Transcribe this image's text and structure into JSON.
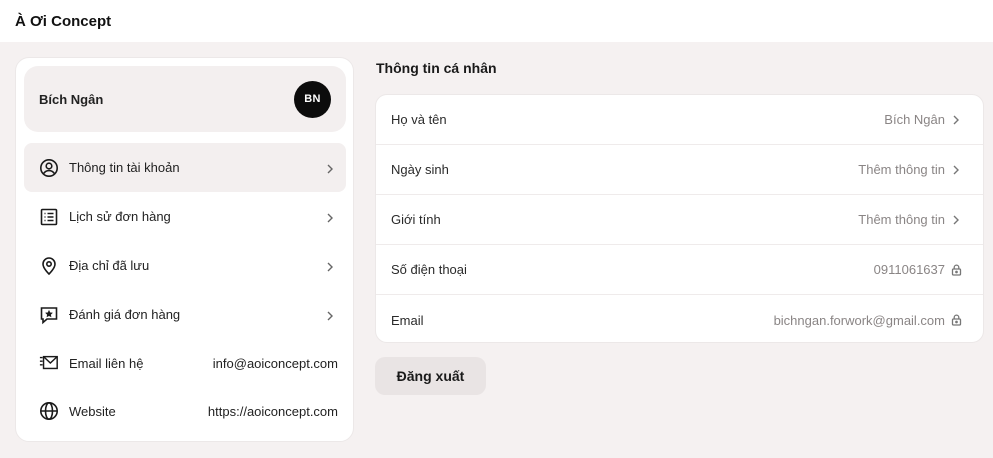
{
  "header": {
    "brand": "À Ơi Concept"
  },
  "profile": {
    "name": "Bích Ngân",
    "initials": "BN"
  },
  "menu": [
    {
      "label": "Thông tin tài khoản",
      "icon": "user-circle-icon",
      "active": true
    },
    {
      "label": "Lịch sử đơn hàng",
      "icon": "list-icon",
      "active": false
    },
    {
      "label": "Địa chỉ đã lưu",
      "icon": "location-pin-icon",
      "active": false
    },
    {
      "label": "Đánh giá đơn hàng",
      "icon": "star-chat-icon",
      "active": false
    }
  ],
  "contact": {
    "email_label": "Email liên hệ",
    "email_value": "info@aoiconcept.com",
    "website_label": "Website",
    "website_value": "https://aoiconcept.com"
  },
  "personal": {
    "title": "Thông tin cá nhân",
    "fields": [
      {
        "label": "Họ và tên",
        "value": "Bích Ngân",
        "end_icon": "chevron-right-icon"
      },
      {
        "label": "Ngày sinh",
        "value": "Thêm thông tin",
        "end_icon": "chevron-right-icon"
      },
      {
        "label": "Giới tính",
        "value": "Thêm thông tin",
        "end_icon": "chevron-right-icon"
      },
      {
        "label": "Số điện thoại",
        "value": "0911061637",
        "end_icon": "lock-icon"
      },
      {
        "label": "Email",
        "value": "bichngan.forwork@gmail.com",
        "end_icon": "lock-icon"
      }
    ]
  },
  "actions": {
    "logout_label": "Đăng xuất"
  },
  "colors": {
    "page_bg": "#f5f1f1",
    "active_bg": "#f3efef",
    "avatar_bg": "#0c0c0c",
    "muted_text": "#8a8585"
  }
}
